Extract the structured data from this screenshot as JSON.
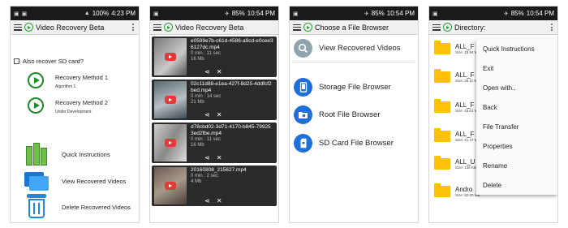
{
  "screens": [
    {
      "status": {
        "time": "4:23 PM",
        "battery": "100%"
      },
      "title": "Video Recovery Beta",
      "checkbox_label": "Also recover SD card?",
      "methods": [
        {
          "title": "Recovery Method 1",
          "subtitle": "Algorithm 1"
        },
        {
          "title": "Recovery Method 2",
          "subtitle": "Under Development"
        }
      ],
      "actions": [
        {
          "label": "Quick Instructions",
          "icon": "books-icon"
        },
        {
          "label": "View Recovered Videos",
          "icon": "folder-icon"
        },
        {
          "label": "Delete Recovered Videos",
          "icon": "trash-icon"
        }
      ]
    },
    {
      "status": {
        "time": "10:54 PM",
        "battery": "85%"
      },
      "title": "Video Recovery Beta",
      "videos": [
        {
          "name": "e0599e7b-c61d-4586-a9cd-e0cee36127dc.mp4",
          "duration": "0 min : 11 sec",
          "size": "16 Mb"
        },
        {
          "name": "02c11d88-e1ea-427f-8d25-4ddfcf2bed.mp4",
          "duration": "0 min : 14 sec",
          "size": "21 Mb"
        },
        {
          "name": "d78cbd02-3d71-4170-b845-799253ed2fbe.mp4",
          "duration": "0 min : 11 sec",
          "size": "16 Mb"
        },
        {
          "name": "20160808_215627.mp4",
          "duration": "0 min : 2 sec",
          "size": "4 Mb"
        }
      ]
    },
    {
      "status": {
        "time": "10:54 PM",
        "battery": "85%"
      },
      "title": "Choose a File Browser",
      "items": [
        {
          "label": "View Recovered Videos",
          "icon": "search-icon",
          "color": "#90a4ae"
        },
        {
          "label": "Storage File Browser",
          "icon": "phone-icon",
          "color": "#1e6fd9"
        },
        {
          "label": "Root File Browser",
          "icon": "settings-folder-icon",
          "color": "#1e6fd9"
        },
        {
          "label": "SD Card File Browser",
          "icon": "sd-card-icon",
          "color": "#1e6fd9"
        }
      ]
    },
    {
      "status": {
        "time": "10:54 PM",
        "battery": "85%"
      },
      "title": "Directory:",
      "folders": [
        {
          "name": "ALL_F",
          "size": "Size: 15.94 MB"
        },
        {
          "name": "ALL_F",
          "size": "Size: 26.11 MB"
        },
        {
          "name": "ALL_F",
          "size": "Size: 43.01 MB"
        },
        {
          "name": "ALL_F",
          "size": "Size: 41.47 MB"
        },
        {
          "name": "ALL_U",
          "size": "Size: 136 KB"
        },
        {
          "name": "Andro",
          "size": "Size: 82.00 MB"
        }
      ],
      "menu": [
        "Quick Instructions",
        "Exit",
        "Open with..",
        "Back",
        "File Transfer",
        "Properties",
        "Rename",
        "Delete"
      ]
    }
  ]
}
